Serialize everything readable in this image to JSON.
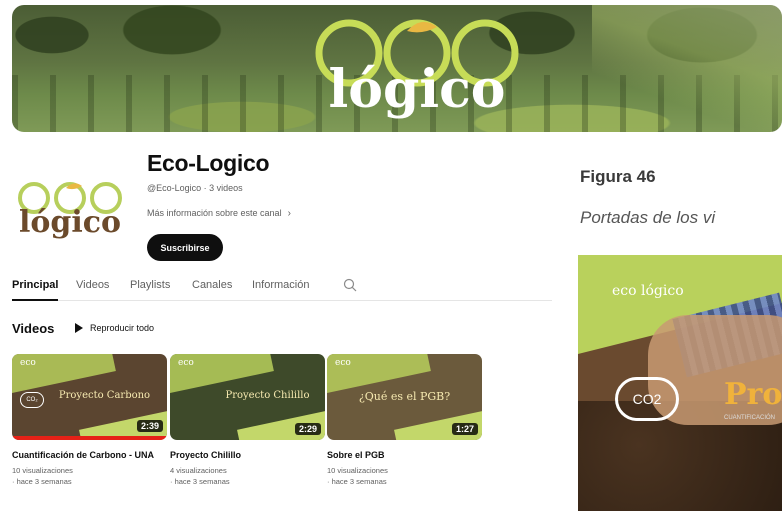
{
  "banner": {
    "logo_top": "eco",
    "logo_bottom": "lógico"
  },
  "channel": {
    "avatar_top": "eco",
    "avatar_bottom": "lógico",
    "name": "Eco-Logico",
    "meta": "@Eco-Logico · 3 videos",
    "more_info": "Más información sobre este canal",
    "subscribe_label": "Suscribirse"
  },
  "tabs": [
    "Principal",
    "Videos",
    "Playlists",
    "Canales",
    "Información"
  ],
  "videos_section": {
    "title": "Videos",
    "play_all": "Reproducir todo",
    "items": [
      {
        "thumb_text": "Proyecto Carbono",
        "duration": "2:39",
        "title": "Cuantificación de Carbono - UNA",
        "views": "10 visualizaciones",
        "age": "· hace 3 semanas",
        "watched": 1.0
      },
      {
        "thumb_text": "Proyecto Chilillo",
        "duration": "2:29",
        "title": "Proyecto Chilillo",
        "views": "4 visualizaciones",
        "age": "· hace 3 semanas"
      },
      {
        "thumb_text": "¿Qué es el PGB?",
        "duration": "1:27",
        "title": "Sobre el PGB",
        "views": "10 visualizaciones",
        "age": "· hace 3 semanas"
      }
    ]
  },
  "document": {
    "figure_label": "Figura 46",
    "figure_caption": "Portadas de los vi",
    "poster": {
      "logo": "eco lógico",
      "co2": "CO2",
      "title": "Proy",
      "subtitle": "CUANTIFICACIÓN"
    }
  },
  "colors": {
    "brand_green": "#b7cf5c",
    "accent_yellow": "#f0b23b",
    "subscribe_bg": "#0f0f0f",
    "progress_red": "#e62117"
  }
}
